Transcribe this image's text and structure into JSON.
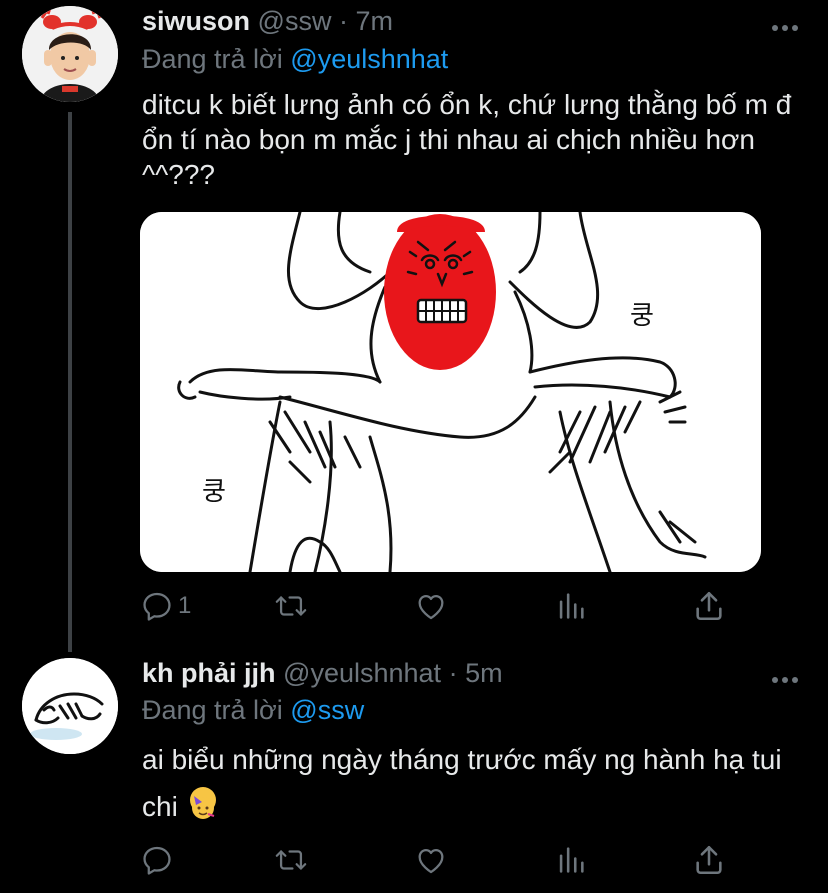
{
  "tweet1": {
    "name": "siwuson",
    "handle": "@ssw",
    "sep": "·",
    "time": "7m",
    "reply_prefix": "Đang trả lời",
    "reply_to": "@yeulshnhat",
    "text": "ditcu k biết lưng ảnh có ổn k, chứ lưng thằng bố m đ ổn tí nào bọn m mắc j thi nhau ai chịch nhiều hơn ^^???",
    "media": {
      "korean_text": "쿵"
    },
    "reply_count": "1",
    "more_icon": "ellipsis-icon"
  },
  "tweet2": {
    "name": "kh phải jjh",
    "handle": "@yeulshnhat",
    "sep": "·",
    "time": "5m",
    "reply_prefix": "Đang trả lời",
    "reply_to": "@ssw",
    "text": "ai biểu những ngày tháng trước mấy ng hành hạ tui chi",
    "emoji": "partying-face",
    "more_icon": "ellipsis-icon"
  },
  "colors": {
    "background": "#000000",
    "accent": "#1d9bf0",
    "muted": "#6e767d",
    "text": "#e7e9ea",
    "thread_line": "#3d4145"
  }
}
